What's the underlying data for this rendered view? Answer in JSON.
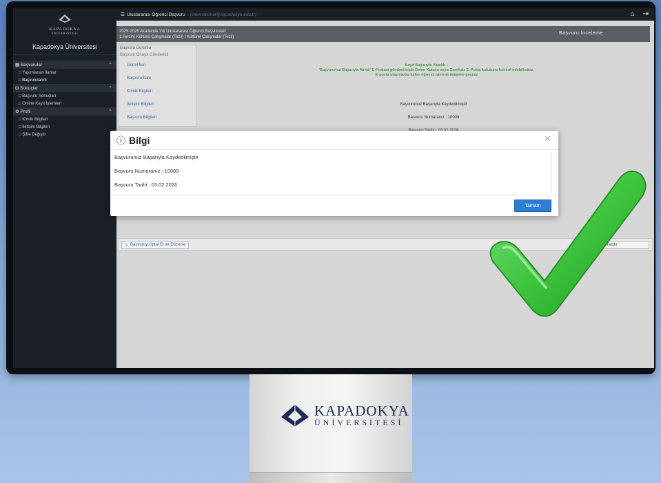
{
  "sidebar": {
    "brand_logo_text": "KAPADOKYA",
    "brand_logo_sub": "ÜNİVERSİTESİ",
    "university_name": "Kapadokya Üniversitesi",
    "sections": [
      {
        "label": "Başvurular",
        "items": [
          "Yayımlanan İlanlar",
          "Başvurularım"
        ]
      },
      {
        "label": "Sonuçlar",
        "items": [
          "Başvuru Sonuçları",
          "Online Kayıt İşlemleri"
        ]
      },
      {
        "label": "Profil",
        "items": [
          "Kimlik Bilgileri",
          "İletişim Bilgileri",
          "Şifre Değiştir"
        ]
      }
    ]
  },
  "topbar": {
    "title": "Uluslararası Öğrenci Başvuru",
    "email": "- (international@kapadokya.edu.tr)",
    "home_icon": "home-icon",
    "logout_icon": "logout-icon"
  },
  "header": {
    "line1": "2025-2026 Akademik Yılı Uluslararası Öğrenci Başvuruları",
    "line2": "1.Tercih) Kültürel Çalışmalar (Tezli) / Kültürel Çalışmalar (Tezli)",
    "right": "Başvuru İnceleme"
  },
  "leftnav": {
    "title1": "Başvuru Durumu",
    "title2": "Başvuru Onaya Gönderildi",
    "items": [
      "Genel İlan",
      "Başvuru İlanı",
      "Kimlik Bilgileri",
      "İletişim Bilgileri",
      "Başvuru Bilgileri"
    ]
  },
  "message": {
    "line1": "Kayıt Başarıyla Yapıldı...",
    "line2": "'Başvurunuz Başarıyla Alındı' E-Postası gönderilmiştir.Gelen Kutusu veya Gereksiz E-Posta kutusunu kontrol edebilirsiniz.",
    "line3": "E-posta ulaşmazsa lütfen öğrenci işleri ile iletişime geçiniz"
  },
  "details": {
    "saved": "Başvurunuz Başarıyla Kaydedilmiştir",
    "number": "Başvuru Numaranız : 10009",
    "date": "Başvuru Tarihi : 03.02.2026"
  },
  "actions": {
    "edit_label": "Başvuruyu İptal Et ve Düzenle",
    "print_label": "uru Yazdır"
  },
  "modal": {
    "title": "Bilgi",
    "line1": "Başvurunuz Başarıyla Kaydedilmiştir",
    "line2": "Başvuru Numaranız : 10009",
    "line3": "Başvuru Tarihi : 03.02.2026",
    "ok_label": "Tamam"
  },
  "stand_logo": {
    "line1": "KAPADOKYA",
    "line2": "ÜNİVERSİTESİ"
  },
  "colors": {
    "sidebar_bg": "#1b1f26",
    "accent_blue": "#2d7fd3",
    "success_green": "#188018",
    "checkmark_green": "#3fc43f"
  }
}
